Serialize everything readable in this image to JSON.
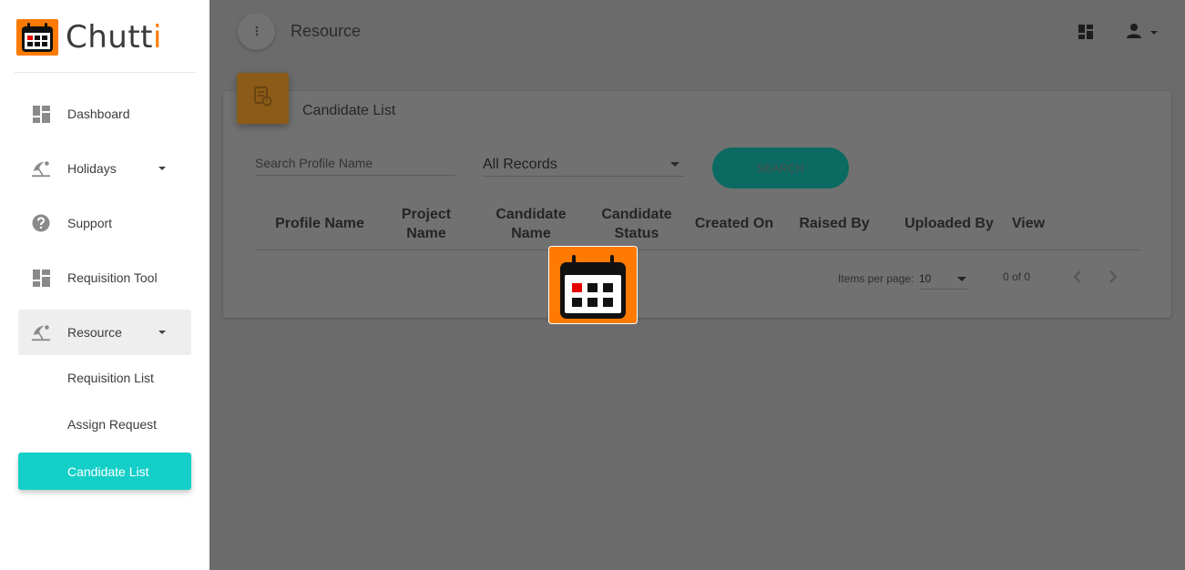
{
  "app": {
    "name_main": "Chutt",
    "name_accent": "i"
  },
  "sidebar": {
    "items": [
      {
        "label": "Dashboard",
        "icon": "dashboard-icon"
      },
      {
        "label": "Holidays",
        "icon": "beach-icon",
        "has_caret": true
      },
      {
        "label": "Support",
        "icon": "help-icon"
      },
      {
        "label": "Requisition Tool",
        "icon": "dashboard-icon"
      },
      {
        "label": "Resource",
        "icon": "beach-icon",
        "has_caret": true,
        "expanded": true
      }
    ],
    "sub_items": [
      {
        "label": "Requisition List"
      },
      {
        "label": "Assign Request"
      },
      {
        "label": "Candidate List",
        "active": true
      }
    ]
  },
  "header": {
    "title": "Resource",
    "menu_icon": "more-vert-icon",
    "right_icons": [
      "dashboard-icon",
      "person-icon"
    ]
  },
  "card": {
    "title": "Candidate List",
    "badge_icon": "document-icon"
  },
  "filters": {
    "search_placeholder": "Search Profile Name",
    "record_select": "All Records",
    "search_button": "SEARCH"
  },
  "table": {
    "columns": [
      "Profile Name",
      "Project\nName",
      "Candidate\nName",
      "Candidate\nStatus",
      "Created On",
      "Raised By",
      "Uploaded By",
      "View"
    ],
    "rows": []
  },
  "pagination": {
    "items_per_page_label": "Items per page:",
    "items_per_page_value": "10",
    "range": "0 of 0"
  },
  "colors": {
    "accent": "#ff7a00",
    "active_nav": "#14cfc7",
    "search_button": "#0b6a62"
  },
  "loader": {
    "icon": "calendar-icon"
  }
}
